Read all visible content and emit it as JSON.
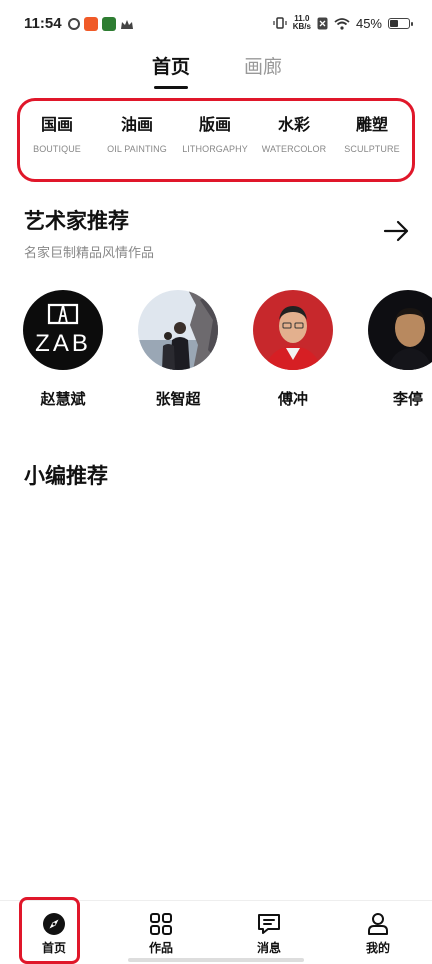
{
  "status_bar": {
    "time": "11:54",
    "net_speed_value": "11.0",
    "net_speed_unit": "KB/s",
    "battery": "45%"
  },
  "top_tabs": [
    {
      "label": "首页",
      "active": true
    },
    {
      "label": "画廊",
      "active": false
    }
  ],
  "categories": [
    {
      "zh": "国画",
      "en": "BOUTIQUE"
    },
    {
      "zh": "油画",
      "en": "OIL PAINTING"
    },
    {
      "zh": "版画",
      "en": "LITHORGAPHY"
    },
    {
      "zh": "水彩",
      "en": "WATERCOLOR"
    },
    {
      "zh": "雕塑",
      "en": "SCULPTURE"
    }
  ],
  "artist_section": {
    "title": "艺术家推荐",
    "subtitle": "名家巨制精品风情作品",
    "arrow_icon": "arrow-right-icon"
  },
  "artists": [
    {
      "name": "赵慧斌",
      "logo_text": "ZAB"
    },
    {
      "name": "张智超"
    },
    {
      "name": "傅冲"
    },
    {
      "name": "李停"
    }
  ],
  "editor_section": {
    "title": "小编推荐"
  },
  "bottom_nav": [
    {
      "label": "首页",
      "icon": "compass-icon",
      "active": true
    },
    {
      "label": "作品",
      "icon": "grid-icon",
      "active": false
    },
    {
      "label": "消息",
      "icon": "message-icon",
      "active": false
    },
    {
      "label": "我的",
      "icon": "user-icon",
      "active": false
    }
  ],
  "colors": {
    "accent_highlight": "#e0172a",
    "text_primary": "#111111",
    "text_secondary": "#888888"
  }
}
